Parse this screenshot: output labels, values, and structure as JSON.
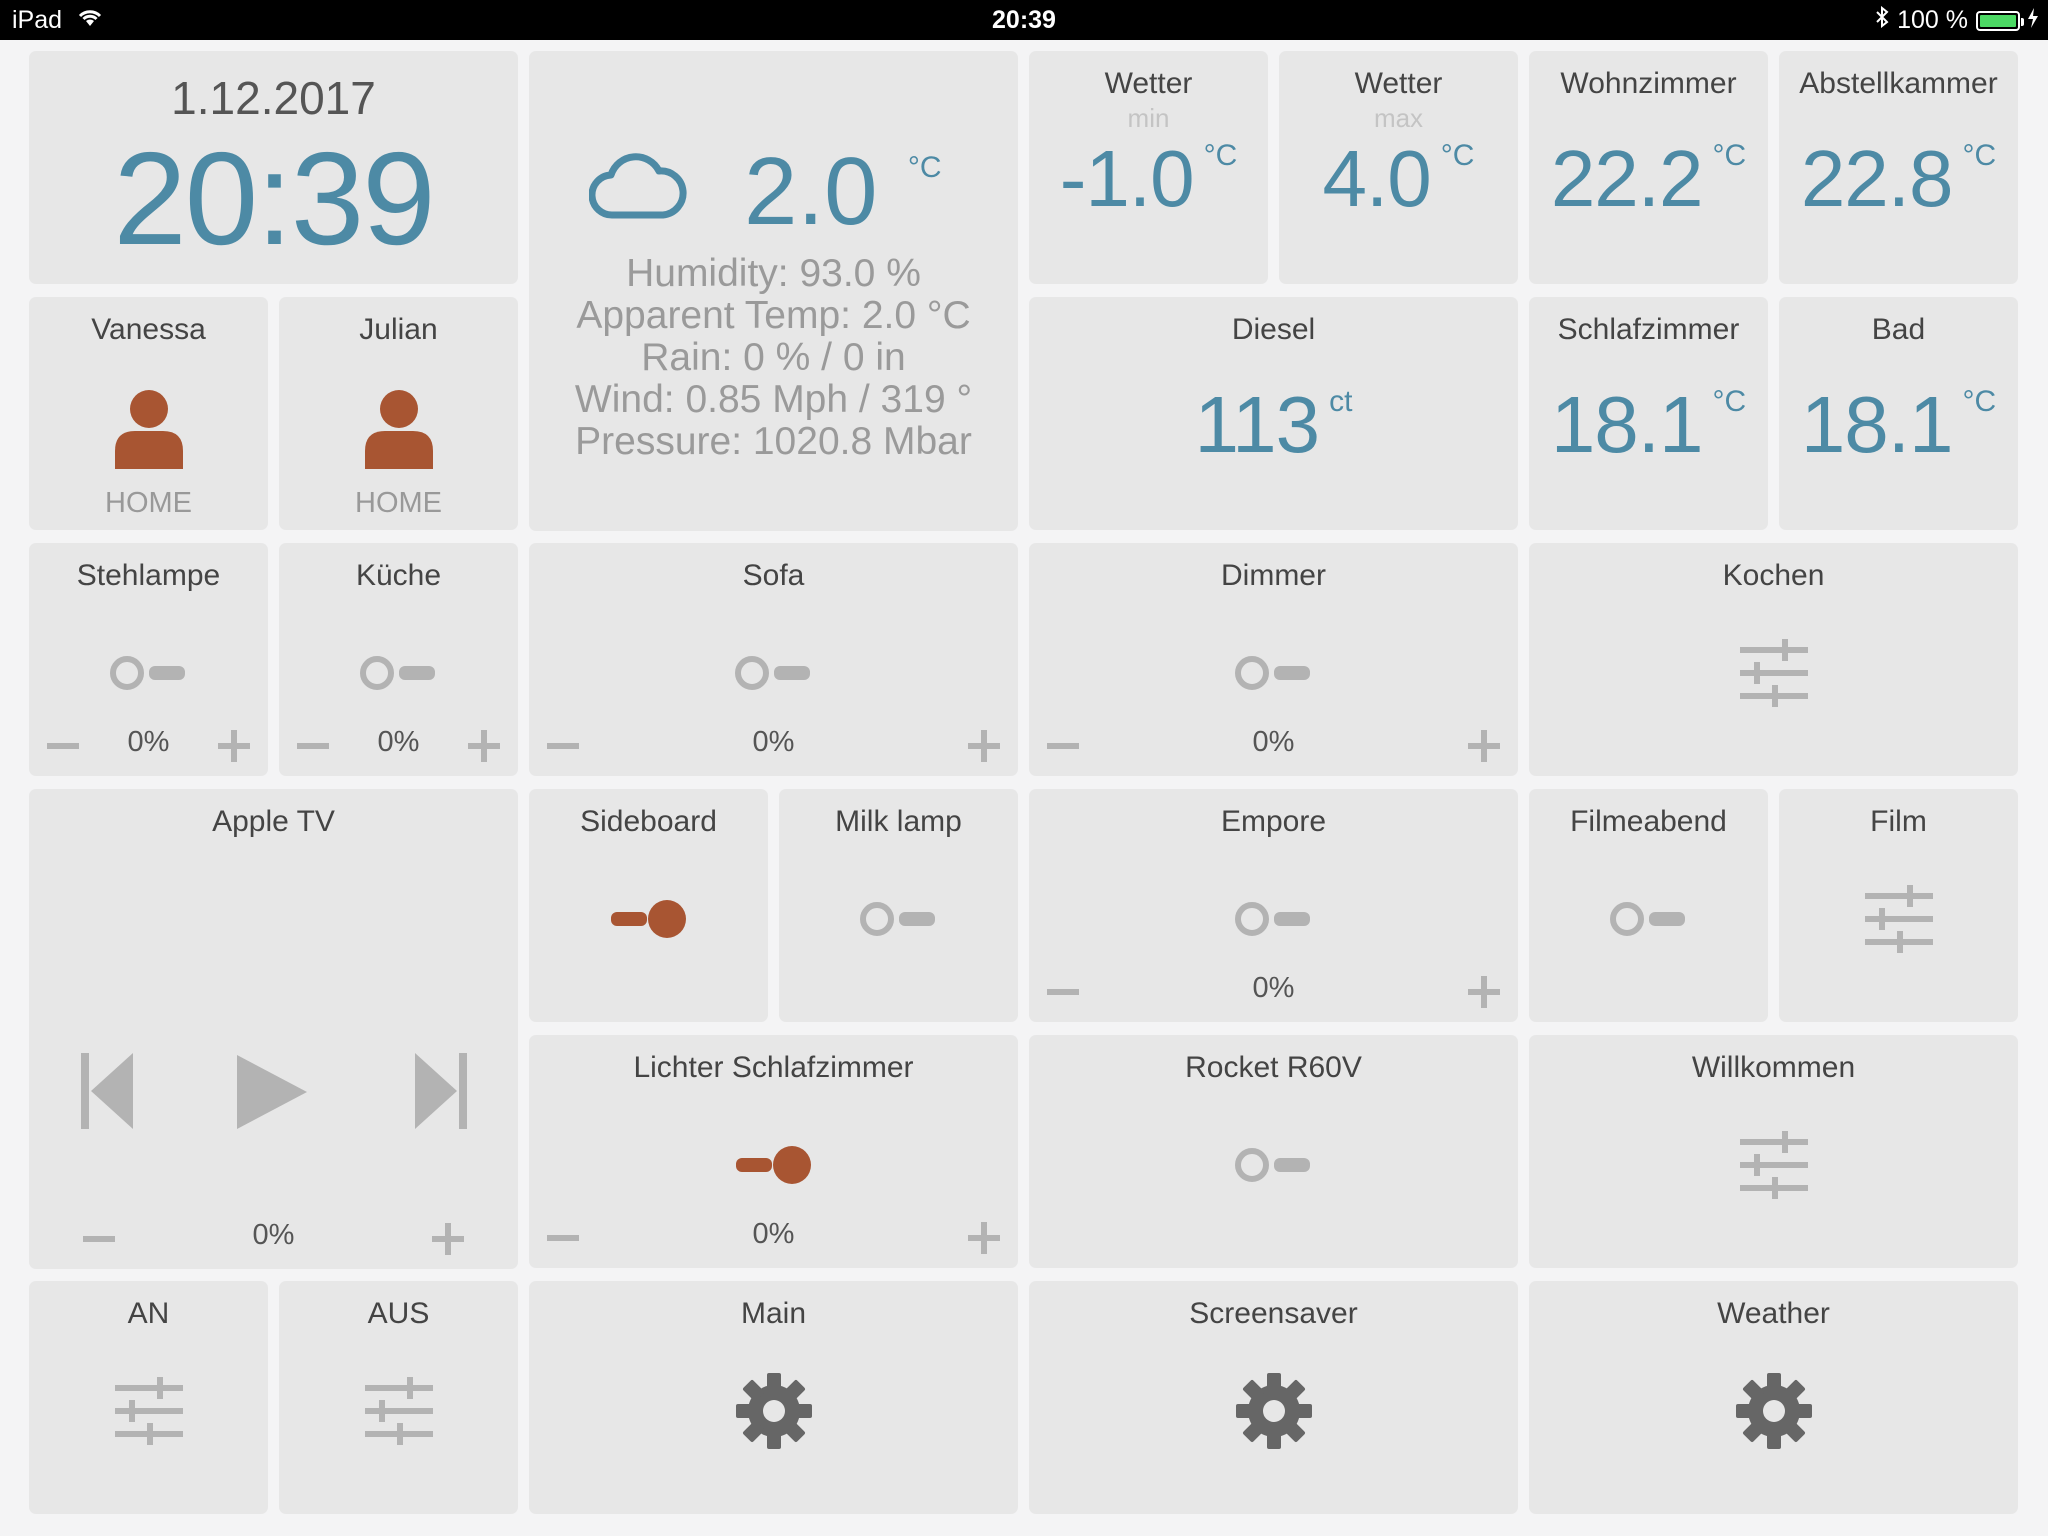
{
  "statusbar": {
    "device": "iPad",
    "time": "20:39",
    "battery": "100 %"
  },
  "clock": {
    "date": "1.12.2017",
    "time": "20:39"
  },
  "weather": {
    "temp": "2.0",
    "unit": "°C",
    "humidity": "Humidity:  93.0 %",
    "apparent": "Apparent Temp:  2.0 °C",
    "rain": "Rain:  0  %  /  0 in",
    "wind": "Wind:  0.85  Mph  /  319  °",
    "pressure": "Pressure:  1020.8  Mbar"
  },
  "sensors": {
    "wetter_min": {
      "title": "Wetter",
      "sub": "min",
      "value": "-1.0",
      "unit": "°C"
    },
    "wetter_max": {
      "title": "Wetter",
      "sub": "max",
      "value": "4.0",
      "unit": "°C"
    },
    "wohnzimmer": {
      "title": "Wohnzimmer",
      "value": "22.2",
      "unit": "°C"
    },
    "abstellkammer": {
      "title": "Abstellkammer",
      "value": "22.8",
      "unit": "°C"
    },
    "diesel": {
      "title": "Diesel",
      "value": "113",
      "unit": "ct"
    },
    "schlafzimmer": {
      "title": "Schlafzimmer",
      "value": "18.1",
      "unit": "°C"
    },
    "bad": {
      "title": "Bad",
      "value": "18.1",
      "unit": "°C"
    }
  },
  "presence": {
    "vanessa": {
      "name": "Vanessa",
      "state": "HOME"
    },
    "julian": {
      "name": "Julian",
      "state": "HOME"
    }
  },
  "dimmers": {
    "stehlampe": {
      "title": "Stehlampe",
      "level": "0%"
    },
    "kueche": {
      "title": "Küche",
      "level": "0%"
    },
    "sofa": {
      "title": "Sofa",
      "level": "0%"
    },
    "dimmer": {
      "title": "Dimmer",
      "level": "0%"
    },
    "empore": {
      "title": "Empore",
      "level": "0%"
    },
    "lichter_schlafzimmer": {
      "title": "Lichter Schlafzimmer",
      "level": "0%"
    }
  },
  "switches": {
    "sideboard": {
      "title": "Sideboard",
      "on": true
    },
    "milk_lamp": {
      "title": "Milk lamp",
      "on": false
    },
    "filmeabend": {
      "title": "Filmeabend",
      "on": false
    },
    "rocket": {
      "title": "Rocket R60V",
      "on": false
    }
  },
  "scenes": {
    "kochen": {
      "title": "Kochen"
    },
    "film": {
      "title": "Film"
    },
    "willkommen": {
      "title": "Willkommen"
    },
    "an": {
      "title": "AN"
    },
    "aus": {
      "title": "AUS"
    }
  },
  "media": {
    "title": "Apple TV",
    "level": "0%"
  },
  "navigation": {
    "main": {
      "title": "Main"
    },
    "screensaver": {
      "title": "Screensaver"
    },
    "weather": {
      "title": "Weather"
    }
  },
  "colors": {
    "accent": "#4d8aa5",
    "on": "#a85532",
    "off": "#b3b3b3",
    "tile": "#e7e7e7"
  }
}
